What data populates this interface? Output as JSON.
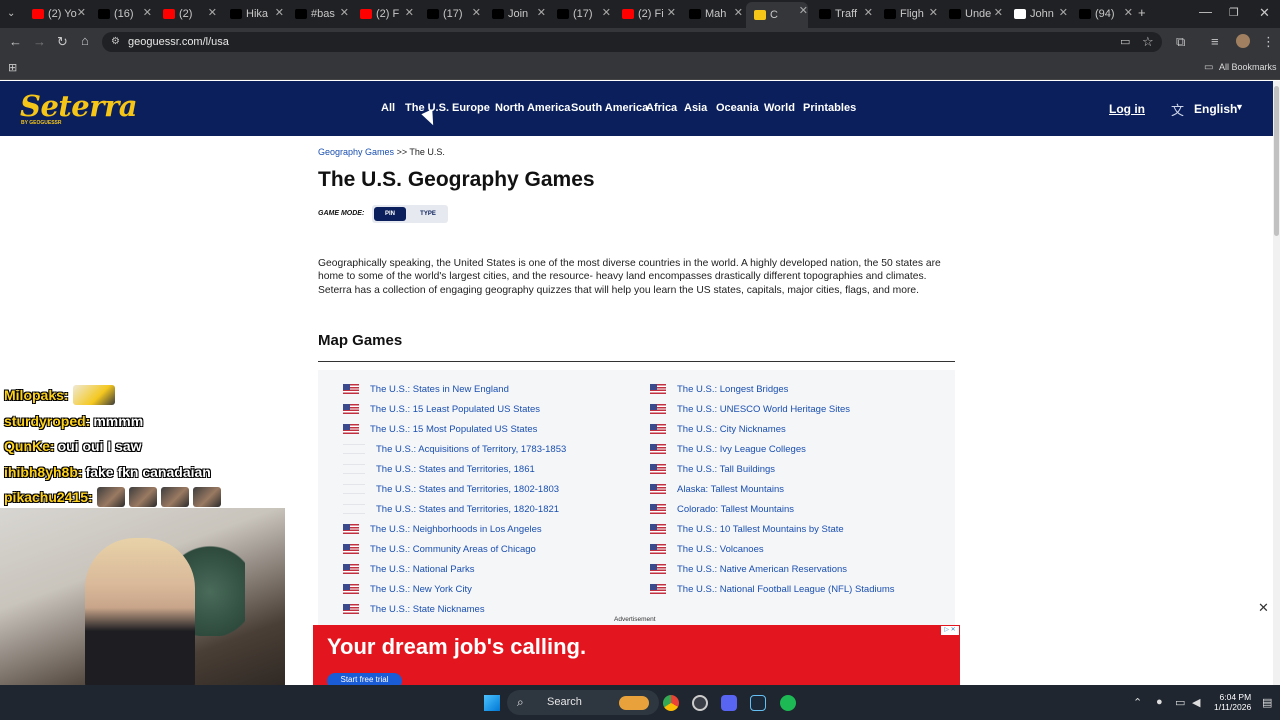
{
  "browser": {
    "tabs": [
      {
        "label": "(2) Yo",
        "icon": "youtube-icon",
        "color": "#ff0000"
      },
      {
        "label": "(16)",
        "icon": "x-icon",
        "color": "#000000"
      },
      {
        "label": "(2)",
        "icon": "youtube-icon",
        "color": "#ff0000"
      },
      {
        "label": "Hika",
        "icon": "tiktok-icon",
        "color": "#000000"
      },
      {
        "label": "#bas",
        "icon": "tiktok-icon",
        "color": "#000000"
      },
      {
        "label": "(2) F",
        "icon": "youtube-icon",
        "color": "#ff0000"
      },
      {
        "label": "(17)",
        "icon": "x-icon",
        "color": "#000000"
      },
      {
        "label": "Join",
        "icon": "tiktok-icon",
        "color": "#000000"
      },
      {
        "label": "(17)",
        "icon": "x-icon",
        "color": "#000000"
      },
      {
        "label": "(2) Fi",
        "icon": "youtube-icon",
        "color": "#ff0000"
      },
      {
        "label": "Mah",
        "icon": "tiktok-icon",
        "color": "#000000"
      },
      {
        "label": "C",
        "icon": "seterra-icon",
        "color": "#f5c518"
      },
      {
        "label": "Traff",
        "icon": "tiktok-icon",
        "color": "#000000"
      },
      {
        "label": "Fligh",
        "icon": "tiktok-icon",
        "color": "#000000"
      },
      {
        "label": "Unde",
        "icon": "tiktok-icon",
        "color": "#000000"
      },
      {
        "label": "John",
        "icon": "wikipedia-icon",
        "color": "#ffffff"
      },
      {
        "label": "(94)",
        "icon": "tiktok-icon",
        "color": "#000000"
      }
    ],
    "active_tab_index": 11,
    "url": "geoguessr.com/l/usa",
    "bookmarks_label": "All Bookmarks"
  },
  "site": {
    "logo": "Seterra",
    "logo_sub": "BY GEOGUESSR",
    "nav": [
      "All",
      "The U.S.",
      "Europe",
      "North America",
      "South America",
      "Africa",
      "Asia",
      "Oceania",
      "World",
      "Printables"
    ],
    "login": "Log in",
    "language": "English"
  },
  "page": {
    "breadcrumb_link": "Geography Games",
    "breadcrumb_sep": ">>",
    "breadcrumb_current": "The U.S.",
    "title": "The U.S. Geography Games",
    "game_mode_label": "GAME MODE:",
    "game_mode_options": [
      "PIN",
      "TYPE"
    ],
    "game_mode_selected": "PIN",
    "description": "Geographically speaking, the United States is one of the most diverse countries in the world. A highly developed nation, the 50 states are home to some of the world's largest cities, and the resource- heavy land encompasses drastically different topographies and climates. Seterra has a collection of engaging geography quizzes that will help you learn the US states, capitals, major cities, flags, and more.",
    "section_heading": "Map Games",
    "games_left": [
      {
        "label": "The U.S.: States in New England",
        "flag": "us"
      },
      {
        "label": "The U.S.: 15 Least Populated US States",
        "flag": "us"
      },
      {
        "label": "The U.S.: 15 Most Populated US States",
        "flag": "us"
      },
      {
        "label": "The U.S.: Acquisitions of Territory, 1783-1853",
        "flag": "blank"
      },
      {
        "label": "The U.S.: States and Territories, 1861",
        "flag": "blank"
      },
      {
        "label": "The U.S.: States and Territories, 1802-1803",
        "flag": "blank"
      },
      {
        "label": "The U.S.: States and Territories, 1820-1821",
        "flag": "blank"
      },
      {
        "label": "The U.S.: Neighborhoods in Los Angeles",
        "flag": "us"
      },
      {
        "label": "The U.S.: Community Areas of Chicago",
        "flag": "us"
      },
      {
        "label": "The U.S.: National Parks",
        "flag": "us"
      },
      {
        "label": "The U.S.: New York City",
        "flag": "us"
      },
      {
        "label": "The U.S.: State Nicknames",
        "flag": "us"
      }
    ],
    "games_right": [
      {
        "label": "The U.S.: Longest Bridges",
        "flag": "us"
      },
      {
        "label": "The U.S.: UNESCO World Heritage Sites",
        "flag": "us"
      },
      {
        "label": "The U.S.: City Nicknames",
        "flag": "us"
      },
      {
        "label": "The U.S.: Ivy League Colleges",
        "flag": "us"
      },
      {
        "label": "The U.S.: Tall Buildings",
        "flag": "us"
      },
      {
        "label": "Alaska: Tallest Mountains",
        "flag": "us"
      },
      {
        "label": "Colorado: Tallest Mountains",
        "flag": "us"
      },
      {
        "label": "The U.S.: 10 Tallest Mountains by State",
        "flag": "us"
      },
      {
        "label": "The U.S.: Volcanoes",
        "flag": "us"
      },
      {
        "label": "The U.S.: Native American Reservations",
        "flag": "us"
      },
      {
        "label": "The U.S.: National Football League (NFL) Stadiums",
        "flag": "us"
      }
    ]
  },
  "ad": {
    "label": "Advertisement",
    "headline": "Your dream job's calling.",
    "cta": "Start free trial",
    "close": "✕"
  },
  "chat": [
    {
      "user": "Milopaks:",
      "text": "",
      "emotes": [
        "hand"
      ]
    },
    {
      "user": "sturdyroped:",
      "text": "mmmm",
      "emotes": []
    },
    {
      "user": "QunKe:",
      "text": "oui oui I saw",
      "emotes": []
    },
    {
      "user": "ihibh8yh8b:",
      "text": "fake fkn canadaian",
      "emotes": []
    },
    {
      "user": "pikachu2415:",
      "text": "",
      "emotes": [
        "face",
        "face",
        "face",
        "face"
      ]
    }
  ],
  "taskbar": {
    "search": "Search",
    "time": "6:04 PM",
    "date": "1/11/2026"
  }
}
